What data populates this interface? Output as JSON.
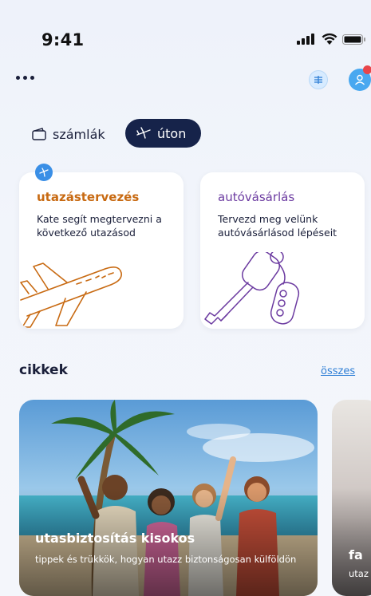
{
  "status_bar": {
    "time": "9:41"
  },
  "header": {
    "more_icon": "ellipsis-icon",
    "filter_icon": "sliders-icon",
    "profile_icon": "user-icon",
    "notification_color": "#e8454a"
  },
  "tabs": [
    {
      "label": "számlák",
      "icon": "wallet-icon",
      "active": false
    },
    {
      "label": "úton",
      "icon": "plane-icon",
      "active": true
    }
  ],
  "cards": [
    {
      "title": "utazástervezés",
      "text": "Kate segít megtervezni a következő utazásod",
      "art": "airplane-illustration",
      "accent": "#c86a12"
    },
    {
      "title": "autóvásárlás",
      "text": "Tervezd meg velünk autóvásárlásod lépéseit",
      "art": "car-key-illustration",
      "accent": "#6b3aa0"
    }
  ],
  "articles_section": {
    "title": "cikkek",
    "all_link": "összes",
    "items": [
      {
        "title": "utasbiztosítás kisokos",
        "subtitle": "tippek és trükkök, hogyan utazz biztonságosan külföldön"
      },
      {
        "title": "fa",
        "subtitle": "utaz"
      }
    ]
  },
  "colors": {
    "primary_dark": "#16234a",
    "link": "#2f7fd6",
    "assistant": "#3a8fe6"
  }
}
